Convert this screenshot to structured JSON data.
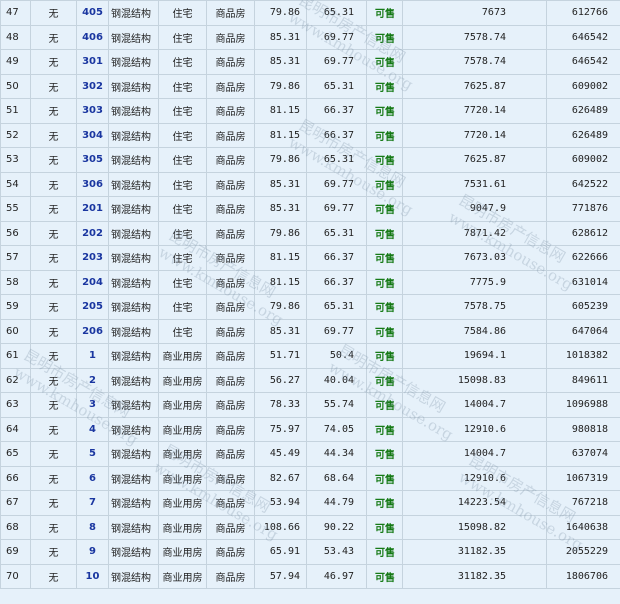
{
  "watermark": {
    "line1": "昆明市房产信息网",
    "line2": "www.kmhouse.org"
  },
  "rows": [
    {
      "no": "47",
      "unit": "无",
      "room": "405",
      "structure": "钢混结构",
      "use": "住宅",
      "type": "商品房",
      "area": "79.86",
      "inner_area": "65.31",
      "status": "可售",
      "unit_price": "7673",
      "total_price": "612766"
    },
    {
      "no": "48",
      "unit": "无",
      "room": "406",
      "structure": "钢混结构",
      "use": "住宅",
      "type": "商品房",
      "area": "85.31",
      "inner_area": "69.77",
      "status": "可售",
      "unit_price": "7578.74",
      "total_price": "646542"
    },
    {
      "no": "49",
      "unit": "无",
      "room": "301",
      "structure": "钢混结构",
      "use": "住宅",
      "type": "商品房",
      "area": "85.31",
      "inner_area": "69.77",
      "status": "可售",
      "unit_price": "7578.74",
      "total_price": "646542"
    },
    {
      "no": "50",
      "unit": "无",
      "room": "302",
      "structure": "钢混结构",
      "use": "住宅",
      "type": "商品房",
      "area": "79.86",
      "inner_area": "65.31",
      "status": "可售",
      "unit_price": "7625.87",
      "total_price": "609002"
    },
    {
      "no": "51",
      "unit": "无",
      "room": "303",
      "structure": "钢混结构",
      "use": "住宅",
      "type": "商品房",
      "area": "81.15",
      "inner_area": "66.37",
      "status": "可售",
      "unit_price": "7720.14",
      "total_price": "626489"
    },
    {
      "no": "52",
      "unit": "无",
      "room": "304",
      "structure": "钢混结构",
      "use": "住宅",
      "type": "商品房",
      "area": "81.15",
      "inner_area": "66.37",
      "status": "可售",
      "unit_price": "7720.14",
      "total_price": "626489"
    },
    {
      "no": "53",
      "unit": "无",
      "room": "305",
      "structure": "钢混结构",
      "use": "住宅",
      "type": "商品房",
      "area": "79.86",
      "inner_area": "65.31",
      "status": "可售",
      "unit_price": "7625.87",
      "total_price": "609002"
    },
    {
      "no": "54",
      "unit": "无",
      "room": "306",
      "structure": "钢混结构",
      "use": "住宅",
      "type": "商品房",
      "area": "85.31",
      "inner_area": "69.77",
      "status": "可售",
      "unit_price": "7531.61",
      "total_price": "642522"
    },
    {
      "no": "55",
      "unit": "无",
      "room": "201",
      "structure": "钢混结构",
      "use": "住宅",
      "type": "商品房",
      "area": "85.31",
      "inner_area": "69.77",
      "status": "可售",
      "unit_price": "9047.9",
      "total_price": "771876"
    },
    {
      "no": "56",
      "unit": "无",
      "room": "202",
      "structure": "钢混结构",
      "use": "住宅",
      "type": "商品房",
      "area": "79.86",
      "inner_area": "65.31",
      "status": "可售",
      "unit_price": "7871.42",
      "total_price": "628612"
    },
    {
      "no": "57",
      "unit": "无",
      "room": "203",
      "structure": "钢混结构",
      "use": "住宅",
      "type": "商品房",
      "area": "81.15",
      "inner_area": "66.37",
      "status": "可售",
      "unit_price": "7673.03",
      "total_price": "622666"
    },
    {
      "no": "58",
      "unit": "无",
      "room": "204",
      "structure": "钢混结构",
      "use": "住宅",
      "type": "商品房",
      "area": "81.15",
      "inner_area": "66.37",
      "status": "可售",
      "unit_price": "7775.9",
      "total_price": "631014"
    },
    {
      "no": "59",
      "unit": "无",
      "room": "205",
      "structure": "钢混结构",
      "use": "住宅",
      "type": "商品房",
      "area": "79.86",
      "inner_area": "65.31",
      "status": "可售",
      "unit_price": "7578.75",
      "total_price": "605239"
    },
    {
      "no": "60",
      "unit": "无",
      "room": "206",
      "structure": "钢混结构",
      "use": "住宅",
      "type": "商品房",
      "area": "85.31",
      "inner_area": "69.77",
      "status": "可售",
      "unit_price": "7584.86",
      "total_price": "647064"
    },
    {
      "no": "61",
      "unit": "无",
      "room": "1",
      "structure": "钢混结构",
      "use": "商业用房",
      "type": "商品房",
      "area": "51.71",
      "inner_area": "50.4",
      "status": "可售",
      "unit_price": "19694.1",
      "total_price": "1018382"
    },
    {
      "no": "62",
      "unit": "无",
      "room": "2",
      "structure": "钢混结构",
      "use": "商业用房",
      "type": "商品房",
      "area": "56.27",
      "inner_area": "40.04",
      "status": "可售",
      "unit_price": "15098.83",
      "total_price": "849611"
    },
    {
      "no": "63",
      "unit": "无",
      "room": "3",
      "structure": "钢混结构",
      "use": "商业用房",
      "type": "商品房",
      "area": "78.33",
      "inner_area": "55.74",
      "status": "可售",
      "unit_price": "14004.7",
      "total_price": "1096988"
    },
    {
      "no": "64",
      "unit": "无",
      "room": "4",
      "structure": "钢混结构",
      "use": "商业用房",
      "type": "商品房",
      "area": "75.97",
      "inner_area": "74.05",
      "status": "可售",
      "unit_price": "12910.6",
      "total_price": "980818"
    },
    {
      "no": "65",
      "unit": "无",
      "room": "5",
      "structure": "钢混结构",
      "use": "商业用房",
      "type": "商品房",
      "area": "45.49",
      "inner_area": "44.34",
      "status": "可售",
      "unit_price": "14004.7",
      "total_price": "637074"
    },
    {
      "no": "66",
      "unit": "无",
      "room": "6",
      "structure": "钢混结构",
      "use": "商业用房",
      "type": "商品房",
      "area": "82.67",
      "inner_area": "68.64",
      "status": "可售",
      "unit_price": "12910.6",
      "total_price": "1067319"
    },
    {
      "no": "67",
      "unit": "无",
      "room": "7",
      "structure": "钢混结构",
      "use": "商业用房",
      "type": "商品房",
      "area": "53.94",
      "inner_area": "44.79",
      "status": "可售",
      "unit_price": "14223.54",
      "total_price": "767218"
    },
    {
      "no": "68",
      "unit": "无",
      "room": "8",
      "structure": "钢混结构",
      "use": "商业用房",
      "type": "商品房",
      "area": "108.66",
      "inner_area": "90.22",
      "status": "可售",
      "unit_price": "15098.82",
      "total_price": "1640638"
    },
    {
      "no": "69",
      "unit": "无",
      "room": "9",
      "structure": "钢混结构",
      "use": "商业用房",
      "type": "商品房",
      "area": "65.91",
      "inner_area": "53.43",
      "status": "可售",
      "unit_price": "31182.35",
      "total_price": "2055229"
    },
    {
      "no": "70",
      "unit": "无",
      "room": "10",
      "structure": "钢混结构",
      "use": "商业用房",
      "type": "商品房",
      "area": "57.94",
      "inner_area": "46.97",
      "status": "可售",
      "unit_price": "31182.35",
      "total_price": "1806706"
    }
  ]
}
